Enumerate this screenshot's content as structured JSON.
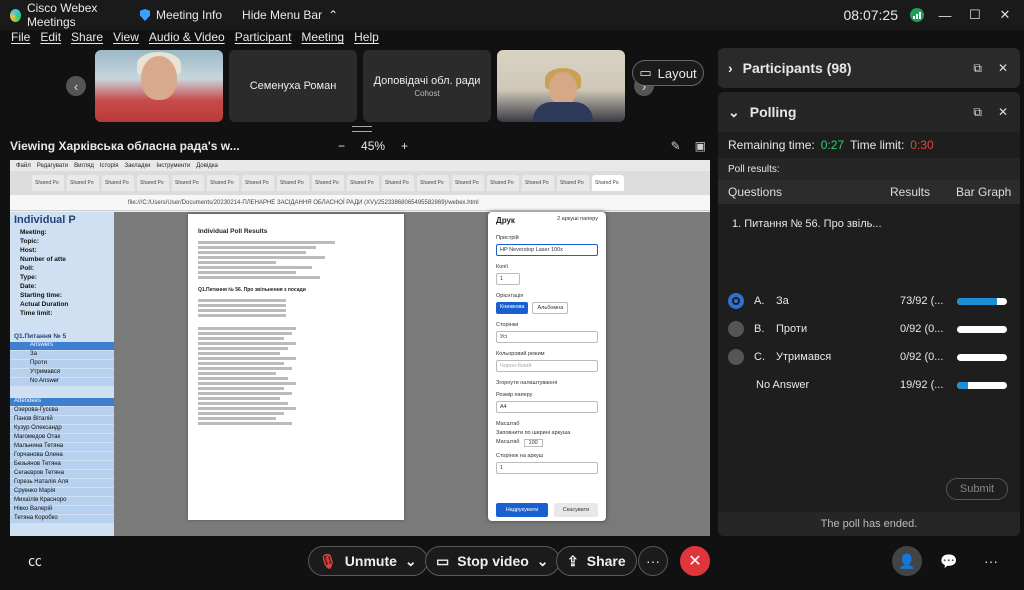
{
  "titlebar": {
    "app_name": "Cisco Webex Meetings",
    "meeting_info": "Meeting Info",
    "hide_menu": "Hide Menu Bar",
    "clock": "08:07:25"
  },
  "menu": [
    "File",
    "Edit",
    "Share",
    "View",
    "Audio & Video",
    "Participant",
    "Meeting",
    "Help"
  ],
  "tiles": [
    {
      "name": "",
      "sub": ""
    },
    {
      "name": "Семенуха Роман",
      "sub": ""
    },
    {
      "name": "Доповідачі обл. ради",
      "sub": "Cohost"
    },
    {
      "name": "",
      "sub": ""
    }
  ],
  "layout_label": "Layout",
  "view": {
    "title": "Viewing Харківська обласна рада's w...",
    "zoom": "45%",
    "minus": "−",
    "plus": "+"
  },
  "shared": {
    "menu_items": [
      "Файл",
      "Редагувати",
      "Вигляд",
      "Історія",
      "Закладки",
      "Інструменти",
      "Довідка"
    ],
    "tab_label": "Shared Po",
    "address": "file:///C:/Users/User/Documents/20230214-ПЛЕНАРНЕ ЗАСІДАННЯ ОБЛАСНОЇ РАДИ (XV)/25233868065495582869)/webex.html",
    "doc_heading": "Individual P",
    "doc_labels": [
      "Meeting:",
      "Topic:",
      "Host:",
      "Number of atte",
      "Poll:",
      "Type:",
      "Date:",
      "Starting time:",
      "Actual Duration",
      "Time limit:"
    ],
    "q1_label": "Q1.Питання № 5",
    "answer_col": "Answers",
    "answers": [
      "За",
      "Проти",
      "Утримався",
      "No Answer"
    ],
    "answer_letters": [
      "A",
      "B",
      "C",
      ""
    ],
    "attendees_label": "Attendees",
    "attendees": [
      "Озерова-Гусєва",
      "Панов Віталій",
      "Кузур Олександр",
      "Магомедов Отак",
      "Мальнина Тетяна",
      "Горчанова Олена",
      "Безьянов Тетяна",
      "Сегаєвров Тетяна",
      "Горезь Наталія Аля",
      "Сруенко Марія",
      "Михаїлів Красноро",
      "Нікко Валерій",
      "Тетяна Коробко"
    ],
    "paper_header": "Individual Poll Results",
    "paper_question": "Q1.Питання № 56. Про звільнення з посади",
    "dialog": {
      "title": "Друк",
      "pages": "2 аркуші паперу",
      "printer_label": "Пристрій",
      "printer": "HP Neverstop Laser 100x",
      "copies_label": "Копії",
      "copies": "1",
      "orientation_label": "Орієнтація",
      "portrait": "Книжкова",
      "landscape": "Альбомна",
      "pages_label": "Сторінки",
      "pages_value": "Усі",
      "color_label": "Кольоровий режим",
      "color_value": "Чорно-білий",
      "more_label": "Згорнути налаштування",
      "paper_label": "Розмір паперу",
      "paper_value": "A4",
      "scale_label": "Масштаб",
      "fit_label": "Заповнити по ширині аркуша",
      "scale_value": "Масштаб",
      "scale_num": "100",
      "per_sheet_label": "Сторінок на аркуш",
      "per_sheet_value": "1",
      "print_btn": "Надрукувати",
      "cancel_btn": "Скасувати"
    }
  },
  "bottom": {
    "unmute": "Unmute",
    "stop_video": "Stop video",
    "share": "Share",
    "more": "···"
  },
  "participants": {
    "title": "Participants (98)"
  },
  "polling": {
    "title": "Polling",
    "remaining_label": "Remaining time:",
    "remaining": "0:27",
    "limit_label": "Time limit:",
    "limit": "0:30",
    "results_label": "Poll results:",
    "col_questions": "Questions",
    "col_results": "Results",
    "col_bar": "Bar Graph",
    "question": "1.  Питання № 56. Про звіль...",
    "options": [
      {
        "letter": "A.",
        "label": "За",
        "count": "73/92 (...",
        "fraction": 0.79,
        "selected": true
      },
      {
        "letter": "B.",
        "label": "Проти",
        "count": "0/92 (0...",
        "fraction": 0.0,
        "selected": false
      },
      {
        "letter": "C.",
        "label": "Утримався",
        "count": "0/92 (0...",
        "fraction": 0.0,
        "selected": false
      },
      {
        "letter": "",
        "label": "No Answer",
        "count": "19/92 (...",
        "fraction": 0.21,
        "selected": false
      }
    ],
    "submit": "Submit",
    "ended": "The poll has ended."
  },
  "colors": {
    "accent_blue": "#1e8fd6",
    "end_call": "#e0353b",
    "remaining_green": "#2ecc71",
    "limit_red": "#e0453b"
  }
}
